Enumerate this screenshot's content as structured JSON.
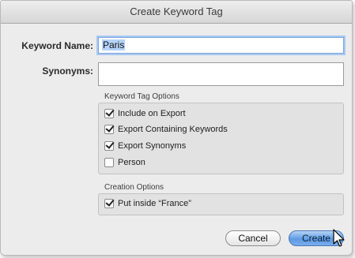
{
  "dialog": {
    "title": "Create Keyword Tag"
  },
  "fields": {
    "keyword_name_label": "Keyword Name:",
    "keyword_name_value": "Paris",
    "synonyms_label": "Synonyms:",
    "synonyms_value": ""
  },
  "keyword_tag_options": {
    "title": "Keyword Tag Options",
    "items": [
      {
        "label": "Include on Export",
        "checked": true
      },
      {
        "label": "Export Containing Keywords",
        "checked": true
      },
      {
        "label": "Export Synonyms",
        "checked": true
      },
      {
        "label": "Person",
        "checked": false
      }
    ]
  },
  "creation_options": {
    "title": "Creation Options",
    "items": [
      {
        "label": "Put inside “France”",
        "checked": true
      }
    ]
  },
  "buttons": {
    "cancel": "Cancel",
    "create": "Create"
  },
  "colors": {
    "dialog_background": "#ececec",
    "focus_ring": "#a9c8f2",
    "default_button": "#5e9be4"
  },
  "icons": {
    "cursor": "mouse-pointer-icon"
  }
}
